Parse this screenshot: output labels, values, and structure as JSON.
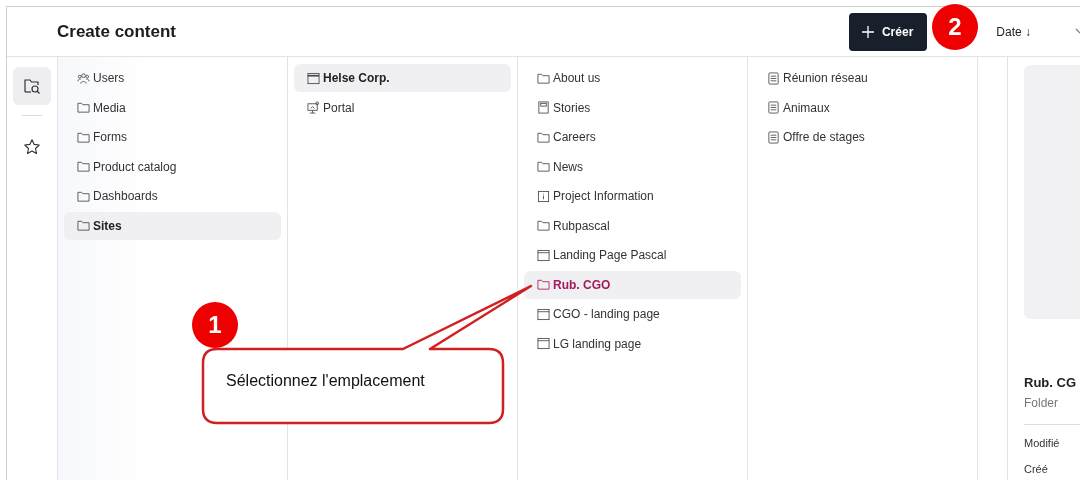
{
  "header": {
    "title": "Create content",
    "create_label": "Créer",
    "sort_label": "Date ↓"
  },
  "rail": [
    {
      "kind": "browse",
      "selected": true
    },
    {
      "kind": "favorites",
      "selected": false
    }
  ],
  "columns": [
    {
      "items": [
        {
          "kind": "users",
          "label": "Users",
          "selected": false,
          "current": false
        },
        {
          "kind": "folder",
          "label": "Media",
          "selected": false,
          "current": false
        },
        {
          "kind": "folder",
          "label": "Forms",
          "selected": false,
          "current": false
        },
        {
          "kind": "folder",
          "label": "Product catalog",
          "selected": false,
          "current": false
        },
        {
          "kind": "folder",
          "label": "Dashboards",
          "selected": false,
          "current": false
        },
        {
          "kind": "folder",
          "label": "Sites",
          "selected": true,
          "current": false
        }
      ]
    },
    {
      "items": [
        {
          "kind": "site",
          "label": "Helse Corp.",
          "selected": true,
          "current": false
        },
        {
          "kind": "portal",
          "label": "Portal",
          "selected": false,
          "current": false
        }
      ]
    },
    {
      "items": [
        {
          "kind": "folder",
          "label": "About us",
          "selected": false,
          "current": false
        },
        {
          "kind": "stories",
          "label": "Stories",
          "selected": false,
          "current": false
        },
        {
          "kind": "folder",
          "label": "Careers",
          "selected": false,
          "current": false
        },
        {
          "kind": "folder",
          "label": "News",
          "selected": false,
          "current": false
        },
        {
          "kind": "info",
          "label": "Project Information",
          "selected": false,
          "current": false
        },
        {
          "kind": "folder",
          "label": "Rubpascal",
          "selected": false,
          "current": false
        },
        {
          "kind": "page",
          "label": "Landing Page Pascal",
          "selected": false,
          "current": false
        },
        {
          "kind": "folder",
          "label": "Rub. CGO",
          "selected": true,
          "current": true
        },
        {
          "kind": "page",
          "label": "CGO - landing page",
          "selected": false,
          "current": false
        },
        {
          "kind": "page",
          "label": "LG landing page",
          "selected": false,
          "current": false
        }
      ]
    },
    {
      "items": [
        {
          "kind": "document",
          "label": "Réunion réseau",
          "selected": false,
          "current": false
        },
        {
          "kind": "document",
          "label": "Animaux",
          "selected": false,
          "current": false
        },
        {
          "kind": "document",
          "label": "Offre de stages",
          "selected": false,
          "current": false
        }
      ]
    }
  ],
  "preview": {
    "title": "Rub. CG",
    "type": "Folder",
    "fields": [
      "Modifié",
      "Créé"
    ]
  },
  "annotations": [
    {
      "number": "1",
      "text": "Sélectionnez l'emplacement"
    },
    {
      "number": "2"
    }
  ]
}
